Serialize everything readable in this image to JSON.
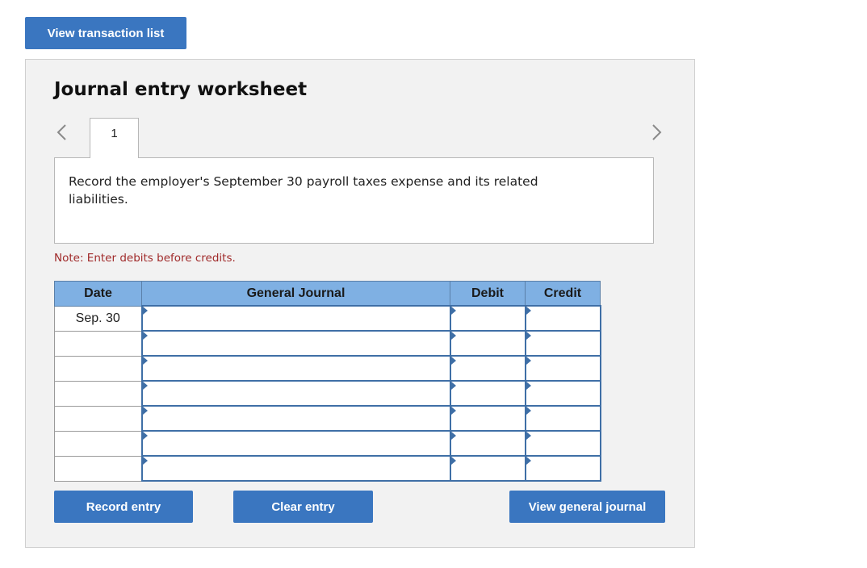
{
  "header": {
    "view_transactions_label": "View transaction list"
  },
  "worksheet": {
    "title": "Journal entry worksheet",
    "tabs": [
      {
        "label": "1"
      }
    ],
    "nav": {
      "prev_icon": "chevron-left-icon",
      "next_icon": "chevron-right-icon"
    },
    "instruction": "Record the employer's September 30 payroll taxes expense and its related liabilities.",
    "note": "Note: Enter debits before credits."
  },
  "journal": {
    "columns": [
      "Date",
      "General Journal",
      "Debit",
      "Credit"
    ],
    "rows": [
      {
        "date": "Sep. 30",
        "account": "",
        "debit": "",
        "credit": ""
      },
      {
        "date": "",
        "account": "",
        "debit": "",
        "credit": ""
      },
      {
        "date": "",
        "account": "",
        "debit": "",
        "credit": ""
      },
      {
        "date": "",
        "account": "",
        "debit": "",
        "credit": ""
      },
      {
        "date": "",
        "account": "",
        "debit": "",
        "credit": ""
      },
      {
        "date": "",
        "account": "",
        "debit": "",
        "credit": ""
      },
      {
        "date": "",
        "account": "",
        "debit": "",
        "credit": ""
      }
    ]
  },
  "actions": {
    "record_label": "Record entry",
    "clear_label": "Clear entry",
    "view_general_journal_label": "View general journal"
  },
  "colors": {
    "button": "#3a76c0",
    "header_fill": "#7fb0e3",
    "note_text": "#a02a2a",
    "input_border": "#3f6fa6"
  }
}
